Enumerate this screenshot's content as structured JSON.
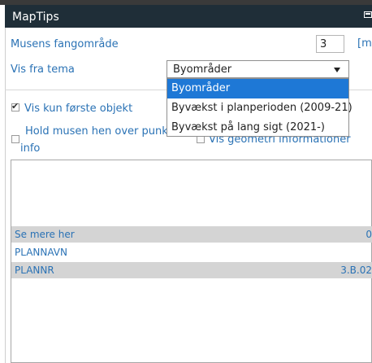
{
  "window": {
    "title": "MapTips"
  },
  "form": {
    "capture_label": "Musens fangområde",
    "capture_value": "3",
    "capture_unit": "[m]",
    "theme_label": "Vis fra tema",
    "theme_selected": "Byområder",
    "theme_options": [
      "Byområder",
      "Byvækst i planperioden (2009-21)",
      "Byvækst på lang sigt (2021-)"
    ],
    "show_first_label": "Vis kun første objekt",
    "show_first_checked": true,
    "hover_label_line1": "Hold musen hen over punkt fo",
    "hover_label_line2": "info",
    "hover_checked": false,
    "geometry_label": "Vis geometri informationer",
    "geometry_checked": false
  },
  "info": {
    "rows": [
      {
        "key": "Se mere her",
        "value": "0"
      },
      {
        "key": "PLANNAVN",
        "value": ""
      },
      {
        "key": "PLANNR",
        "value": "3.B.02"
      }
    ]
  }
}
